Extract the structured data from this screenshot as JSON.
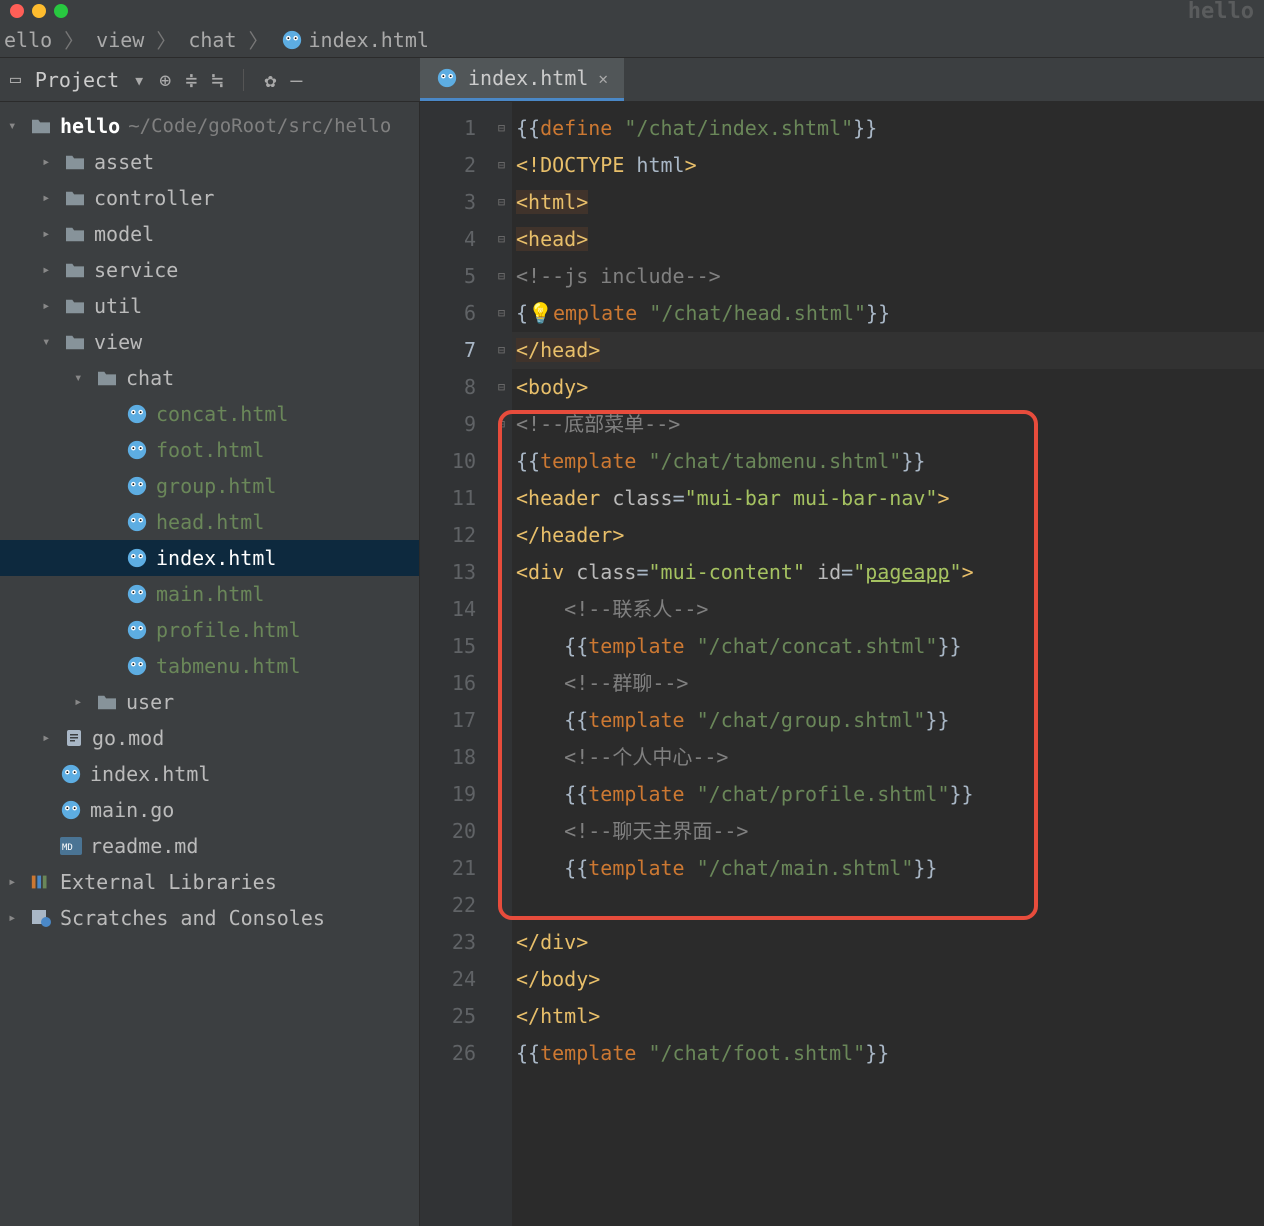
{
  "window": {
    "title": "hello"
  },
  "breadcrumb": {
    "p0": "ello",
    "p1": "view",
    "p2": "chat",
    "p3": "index.html"
  },
  "toolbar": {
    "project_label": "Project"
  },
  "tabs": {
    "active": {
      "label": "index.html"
    }
  },
  "tree": {
    "root": {
      "name": "hello",
      "path": "~/Code/goRoot/src/hello"
    },
    "asset": "asset",
    "controller": "controller",
    "model": "model",
    "service": "service",
    "util": "util",
    "view": "view",
    "chat": "chat",
    "concat": "concat.html",
    "foot": "foot.html",
    "group": "group.html",
    "head": "head.html",
    "index": "index.html",
    "main": "main.html",
    "profile": "profile.html",
    "tabmenu": "tabmenu.html",
    "user": "user",
    "gomod": "go.mod",
    "indexhtml": "index.html",
    "maingo": "main.go",
    "readme": "readme.md",
    "external": "External Libraries",
    "scratches": "Scratches and Consoles"
  },
  "gutter": {
    "lines": [
      "1",
      "2",
      "3",
      "4",
      "5",
      "6",
      "7",
      "8",
      "9",
      "10",
      "11",
      "12",
      "13",
      "14",
      "15",
      "16",
      "17",
      "18",
      "19",
      "20",
      "21",
      "22",
      "23",
      "24",
      "25",
      "26"
    ],
    "active": "7"
  },
  "code": {
    "l1": {
      "a": "{{",
      "b": "define ",
      "c": "\"/chat/index.shtml\"",
      "d": "}}"
    },
    "l2": {
      "a": "<!",
      "b": "DOCTYPE ",
      "c": "html",
      "d": ">"
    },
    "l3": {
      "a": "<",
      "b": "html",
      "c": ">"
    },
    "l4": {
      "a": "<",
      "b": "head",
      "c": ">"
    },
    "l5": {
      "a": "<!--js include-->"
    },
    "l6": {
      "a": "{",
      "bulb": "💡",
      "b": "emplate ",
      "c": "\"/chat/head.shtml\"",
      "d": "}}"
    },
    "l7": {
      "a": "</",
      "b": "head",
      "c": ">"
    },
    "l8": {
      "a": "<",
      "b": "body",
      "c": ">"
    },
    "l9": {
      "a": "<!--底部菜单-->"
    },
    "l10": {
      "a": "{{",
      "b": "template ",
      "c": "\"/chat/tabmenu.shtml\"",
      "d": "}}"
    },
    "l11": {
      "a": "<",
      "b": "header ",
      "c": "class",
      "d": "=",
      "e": "\"mui-bar mui-bar-nav\"",
      "f": ">"
    },
    "l12": {
      "a": "</",
      "b": "header",
      "c": ">"
    },
    "l13": {
      "a": "<",
      "b": "div ",
      "c": "class",
      "d": "=",
      "e": "\"mui-content\" ",
      "f": "id",
      "g": "=",
      "h": "\"",
      "i": "pageapp",
      "j": "\"",
      "k": ">"
    },
    "l14": {
      "a": "<!--联系人-->"
    },
    "l15": {
      "a": "{{",
      "b": "template ",
      "c": "\"/chat/concat.shtml\"",
      "d": "}}"
    },
    "l16": {
      "a": "<!--群聊-->"
    },
    "l17": {
      "a": "{{",
      "b": "template ",
      "c": "\"/chat/group.shtml\"",
      "d": "}}"
    },
    "l18": {
      "a": "<!--个人中心-->"
    },
    "l19": {
      "a": "{{",
      "b": "template ",
      "c": "\"/chat/profile.shtml\"",
      "d": "}}"
    },
    "l20": {
      "a": "<!--聊天主界面-->"
    },
    "l21": {
      "a": "{{",
      "b": "template ",
      "c": "\"/chat/main.shtml\"",
      "d": "}}"
    },
    "l23": {
      "a": "</",
      "b": "div",
      "c": ">"
    },
    "l24": {
      "a": "</",
      "b": "body",
      "c": ">"
    },
    "l25": {
      "a": "</",
      "b": "html",
      "c": ">"
    },
    "l26": {
      "a": "{{",
      "b": "template ",
      "c": "\"/chat/foot.shtml\"",
      "d": "}}"
    }
  }
}
